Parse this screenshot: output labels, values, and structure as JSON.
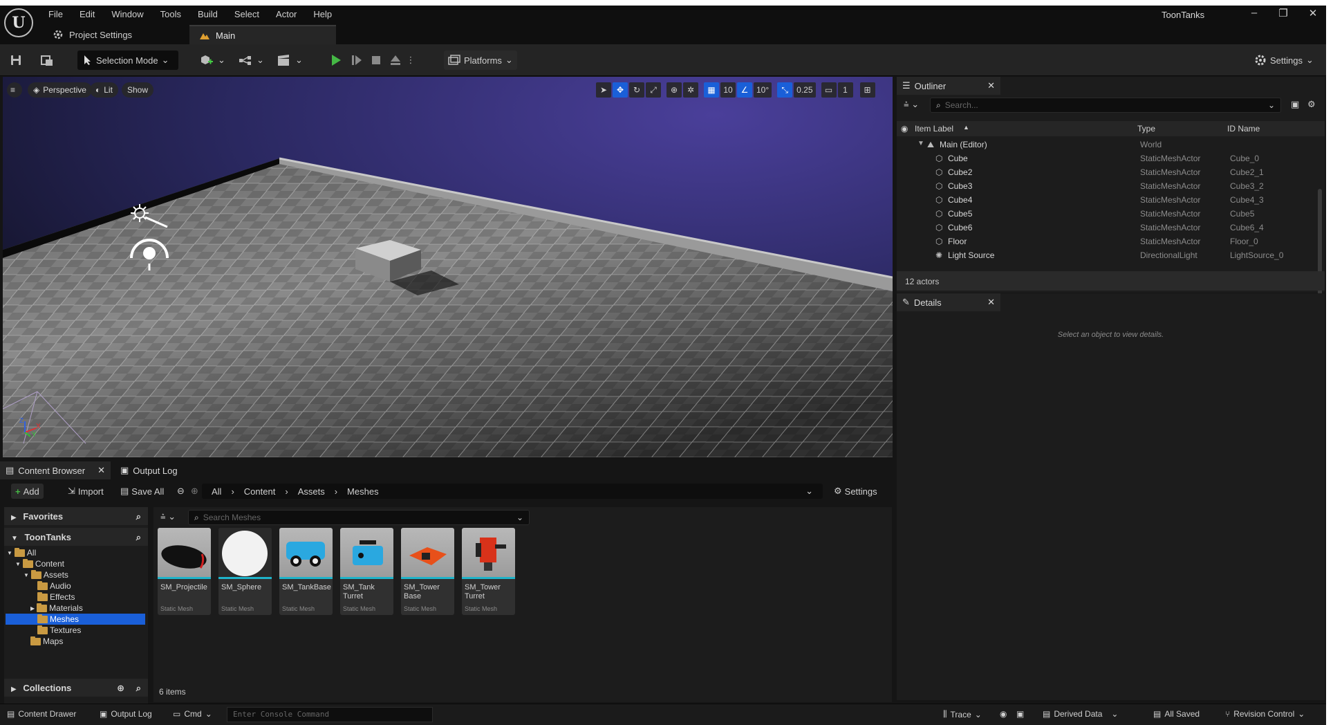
{
  "window": {
    "app_title": "ToonTanks",
    "minimize": "–",
    "restore": "❐",
    "close": "✕"
  },
  "menu": [
    "File",
    "Edit",
    "Window",
    "Tools",
    "Build",
    "Select",
    "Actor",
    "Help"
  ],
  "tabs": {
    "project_settings": "Project Settings",
    "main": "Main"
  },
  "toolbar": {
    "selection_mode": "Selection Mode",
    "platforms": "Platforms",
    "settings": "Settings"
  },
  "viewport": {
    "perspective": "Perspective",
    "lit": "Lit",
    "show": "Show",
    "grid_snap": "10",
    "rotation_snap": "10°",
    "scale_snap": "0.25",
    "camera_speed": "1",
    "axis_x": "X",
    "axis_y": "Y",
    "axis_z": "Z"
  },
  "outliner": {
    "title": "Outliner",
    "search_placeholder": "Search...",
    "columns": {
      "label": "Item Label",
      "type": "Type",
      "id": "ID Name"
    },
    "root": {
      "label": "Main (Editor)",
      "type": "World"
    },
    "rows": [
      {
        "label": "Cube",
        "type": "StaticMeshActor",
        "id": "Cube_0"
      },
      {
        "label": "Cube2",
        "type": "StaticMeshActor",
        "id": "Cube2_1"
      },
      {
        "label": "Cube3",
        "type": "StaticMeshActor",
        "id": "Cube3_2"
      },
      {
        "label": "Cube4",
        "type": "StaticMeshActor",
        "id": "Cube4_3"
      },
      {
        "label": "Cube5",
        "type": "StaticMeshActor",
        "id": "Cube5"
      },
      {
        "label": "Cube6",
        "type": "StaticMeshActor",
        "id": "Cube6_4"
      },
      {
        "label": "Floor",
        "type": "StaticMeshActor",
        "id": "Floor_0"
      },
      {
        "label": "Light Source",
        "type": "DirectionalLight",
        "id": "LightSource_0"
      }
    ],
    "actor_count": "12 actors"
  },
  "details": {
    "title": "Details",
    "empty": "Select an object to view details."
  },
  "content_browser": {
    "tab": "Content Browser",
    "output_log_tab": "Output Log",
    "add": "Add",
    "import": "Import",
    "save_all": "Save All",
    "breadcrumbs": [
      "All",
      "Content",
      "Assets",
      "Meshes"
    ],
    "settings": "Settings",
    "favorites": "Favorites",
    "project": "ToonTanks",
    "folders": [
      "All",
      "Content",
      "Assets",
      "Audio",
      "Effects",
      "Materials",
      "Meshes",
      "Textures",
      "Maps"
    ],
    "collections": "Collections",
    "search_placeholder": "Search Meshes",
    "assets": [
      {
        "name": "SM_Projectile",
        "type": "Static Mesh"
      },
      {
        "name": "SM_Sphere",
        "type": "Static Mesh"
      },
      {
        "name": "SM_TankBase",
        "type": "Static Mesh"
      },
      {
        "name": "SM_Tank Turret",
        "type": "Static Mesh"
      },
      {
        "name": "SM_Tower Base",
        "type": "Static Mesh"
      },
      {
        "name": "SM_Tower Turret",
        "type": "Static Mesh"
      }
    ],
    "item_count": "6 items"
  },
  "statusbar": {
    "content_drawer": "Content Drawer",
    "output_log": "Output Log",
    "cmd": "Cmd",
    "console_placeholder": "Enter Console Command",
    "trace": "Trace",
    "derived_data": "Derived Data",
    "all_saved": "All Saved",
    "revision_control": "Revision Control"
  },
  "colors": {
    "accent": "#1a5fd8",
    "play_green": "#45b845",
    "folder": "#c99a42",
    "asset_underline": "#1fb3c9"
  }
}
